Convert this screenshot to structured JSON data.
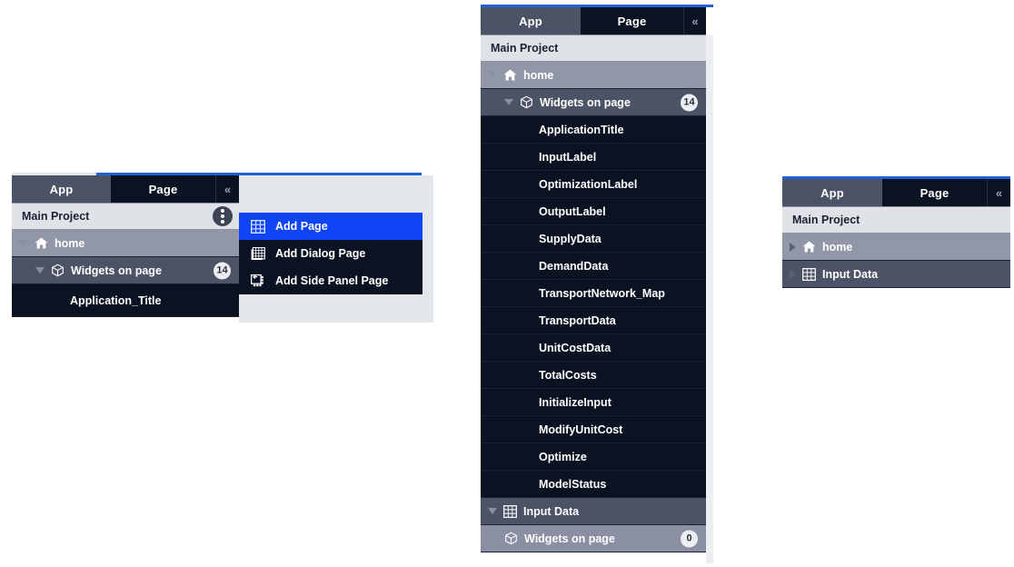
{
  "tabs": {
    "app": "App",
    "page": "Page",
    "collapse": "«"
  },
  "left": {
    "project": "Main Project",
    "nodes": [
      {
        "label": "home",
        "icon": "home-icon",
        "caret": "down"
      },
      {
        "label": "Widgets on page",
        "icon": "widget-cube-icon",
        "caret": "down",
        "badge": "14"
      },
      {
        "label": "Application_Title",
        "icon": "none",
        "caret": "none"
      }
    ],
    "menu": [
      {
        "label": "Add Page",
        "icon": "grid-page-icon",
        "highlight": true
      },
      {
        "label": "Add Dialog Page",
        "icon": "dialog-page-icon",
        "highlight": false
      },
      {
        "label": "Add Side Panel Page",
        "icon": "side-panel-page-icon",
        "highlight": false
      }
    ],
    "more_menu_label": "⋮"
  },
  "middle": {
    "project": "Main Project",
    "home": {
      "label": "home",
      "caret": "down"
    },
    "widgets_header": {
      "label": "Widgets on page",
      "badge": "14",
      "caret": "down"
    },
    "widgets": [
      "ApplicationTitle",
      "InputLabel",
      "OptimizationLabel",
      "OutputLabel",
      "SupplyData",
      "DemandData",
      "TransportNetwork_Map",
      "TransportData",
      "UnitCostData",
      "TotalCosts",
      "InitializeInput",
      "ModifyUnitCost",
      "Optimize",
      "ModelStatus"
    ],
    "input_data": {
      "label": "Input Data",
      "caret": "down"
    },
    "input_widgets": {
      "label": "Widgets on page",
      "badge": "0"
    }
  },
  "right": {
    "project": "Main Project",
    "nodes": [
      {
        "label": "home",
        "icon": "home-icon",
        "caret": "right"
      },
      {
        "label": "Input Data",
        "icon": "grid-page-icon",
        "caret": "right"
      }
    ]
  },
  "colors": {
    "accent_blue": "#1f62d6",
    "menu_highlight": "#1144f5",
    "tab_active": "#4d5366",
    "tab_inactive": "#0b1222",
    "tree_dark": "#0b1222",
    "tree_slate": "#4d5366",
    "tree_gray": "#9297a8",
    "project_bg": "#dfe2e7"
  }
}
